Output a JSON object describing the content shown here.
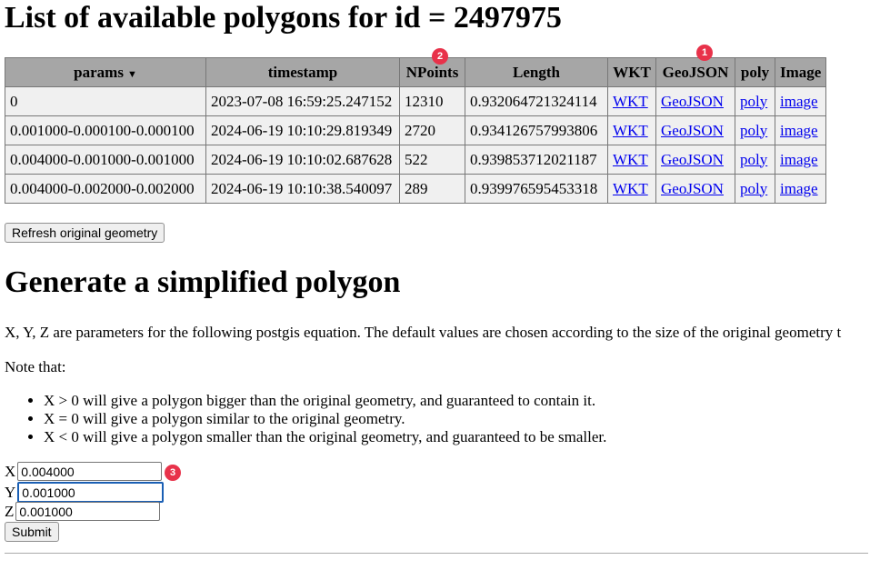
{
  "title": "List of available polygons for id = 2497975",
  "table": {
    "headers": [
      "params",
      "timestamp",
      "NPoints",
      "Length",
      "WKT",
      "GeoJSON",
      "poly",
      "Image"
    ],
    "sort_indicator": "▼",
    "rows": [
      {
        "params": "0",
        "timestamp": "2023-07-08 16:59:25.247152",
        "npoints": "12310",
        "length": "0.932064721324114",
        "wkt": "WKT",
        "geojson": "GeoJSON",
        "poly": "poly",
        "image": "image"
      },
      {
        "params": "0.001000-0.000100-0.000100",
        "timestamp": "2024-06-19 10:10:29.819349",
        "npoints": "2720",
        "length": "0.934126757993806",
        "wkt": "WKT",
        "geojson": "GeoJSON",
        "poly": "poly",
        "image": "image"
      },
      {
        "params": "0.004000-0.001000-0.001000",
        "timestamp": "2024-06-19 10:10:02.687628",
        "npoints": "522",
        "length": "0.939853712021187",
        "wkt": "WKT",
        "geojson": "GeoJSON",
        "poly": "poly",
        "image": "image"
      },
      {
        "params": "0.004000-0.002000-0.002000",
        "timestamp": "2024-06-19 10:10:38.540097",
        "npoints": "289",
        "length": "0.939976595453318",
        "wkt": "WKT",
        "geojson": "GeoJSON",
        "poly": "poly",
        "image": "image"
      }
    ]
  },
  "refresh_button": "Refresh original geometry",
  "section_title": "Generate a simplified polygon",
  "description": "X, Y, Z are parameters for the following postgis equation. The default values are chosen according to the size of the original geometry t",
  "note_label": "Note that:",
  "notes": [
    "X > 0 will give a polygon bigger than the original geometry, and guaranteed to contain it.",
    "X = 0 will give a polygon similar to the original geometry.",
    "X < 0 will give a polygon smaller than the original geometry, and guaranteed to be smaller."
  ],
  "form": {
    "x_label": "X",
    "x_value": "0.004000",
    "y_label": "Y",
    "y_value": "0.001000",
    "z_label": "Z",
    "z_value": "0.001000",
    "submit": "Submit"
  },
  "badges": [
    "1",
    "2",
    "3"
  ],
  "colors": {
    "badge": "#e8324a",
    "header_bg": "#a6a6a6",
    "cell_bg": "#f0f0f0",
    "link": "#0000ee"
  }
}
